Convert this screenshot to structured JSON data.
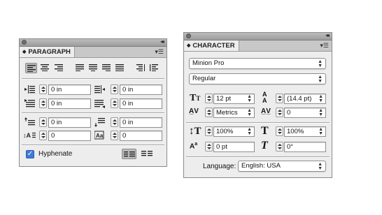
{
  "paragraph_panel": {
    "title": "PARAGRAPH",
    "indents": {
      "left": "0 in",
      "right": "0 in",
      "first_line": "0 in",
      "last_line": "0 in"
    },
    "spacing": {
      "before": "0 in",
      "after": "0 in",
      "drop_cap_lines": "0",
      "drop_cap_chars": "0"
    },
    "hyphenate_label": "Hyphenate",
    "hyphenate_checked": true,
    "alignment_buttons": [
      "align-left",
      "align-center",
      "align-right",
      "justify-left",
      "justify-center",
      "justify-right",
      "justify-all",
      "align-toward-spine",
      "align-away-from-spine"
    ]
  },
  "character_panel": {
    "title": "CHARACTER",
    "font_family": "Minion Pro",
    "font_style": "Regular",
    "font_size": "12 pt",
    "leading": "(14.4 pt)",
    "kerning": "Metrics",
    "tracking": "0",
    "vertical_scale": "100%",
    "horizontal_scale": "100%",
    "baseline_shift": "0 pt",
    "skew": "0°",
    "language_label": "Language:",
    "language": "English: USA"
  },
  "colors": {
    "panel_bg": "#ededed",
    "titlebar": "#9c9c9c",
    "checkbox": "#3f7ad8"
  }
}
